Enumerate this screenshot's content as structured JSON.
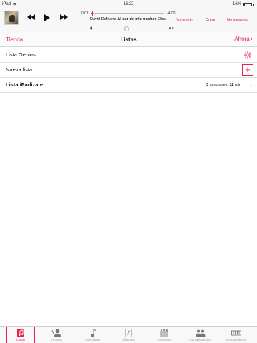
{
  "status": {
    "device": "iPad",
    "time": "16:22",
    "battery": "16%"
  },
  "player": {
    "elapsed": "0:01",
    "remaining": "-4:00",
    "artist": "David DeMaría",
    "song": "Al sur de mis noches",
    "album_fragment": "Otra",
    "repeat_label": "No repetir",
    "create_label": "Crear",
    "shuffle_label": "No aleatorio",
    "progress": 0.01,
    "volume": 0.42
  },
  "nav": {
    "back_label": "Tienda",
    "title": "Listas",
    "now_label": "Ahora"
  },
  "rows": [
    {
      "label": "Lista Genius"
    },
    {
      "label": "Nueva lista..."
    },
    {
      "label": "Lista iPadizate",
      "meta_count": "3",
      "meta_count_word": " canciones, ",
      "meta_duration": "12",
      "meta_duration_word": " min"
    }
  ],
  "tabs": [
    {
      "label": "Listas",
      "icon": "playlist-icon"
    },
    {
      "label": "Artistas",
      "icon": "artist-icon"
    },
    {
      "label": "Canciones",
      "icon": "music-note-icon"
    },
    {
      "label": "Álbumes",
      "icon": "album-icon"
    },
    {
      "label": "Géneros",
      "icon": "genre-icon"
    },
    {
      "label": "Recopilaciones",
      "icon": "compilations-icon"
    },
    {
      "label": "Compositores",
      "icon": "composer-icon"
    }
  ],
  "colors": {
    "accent": "#e6224b"
  }
}
